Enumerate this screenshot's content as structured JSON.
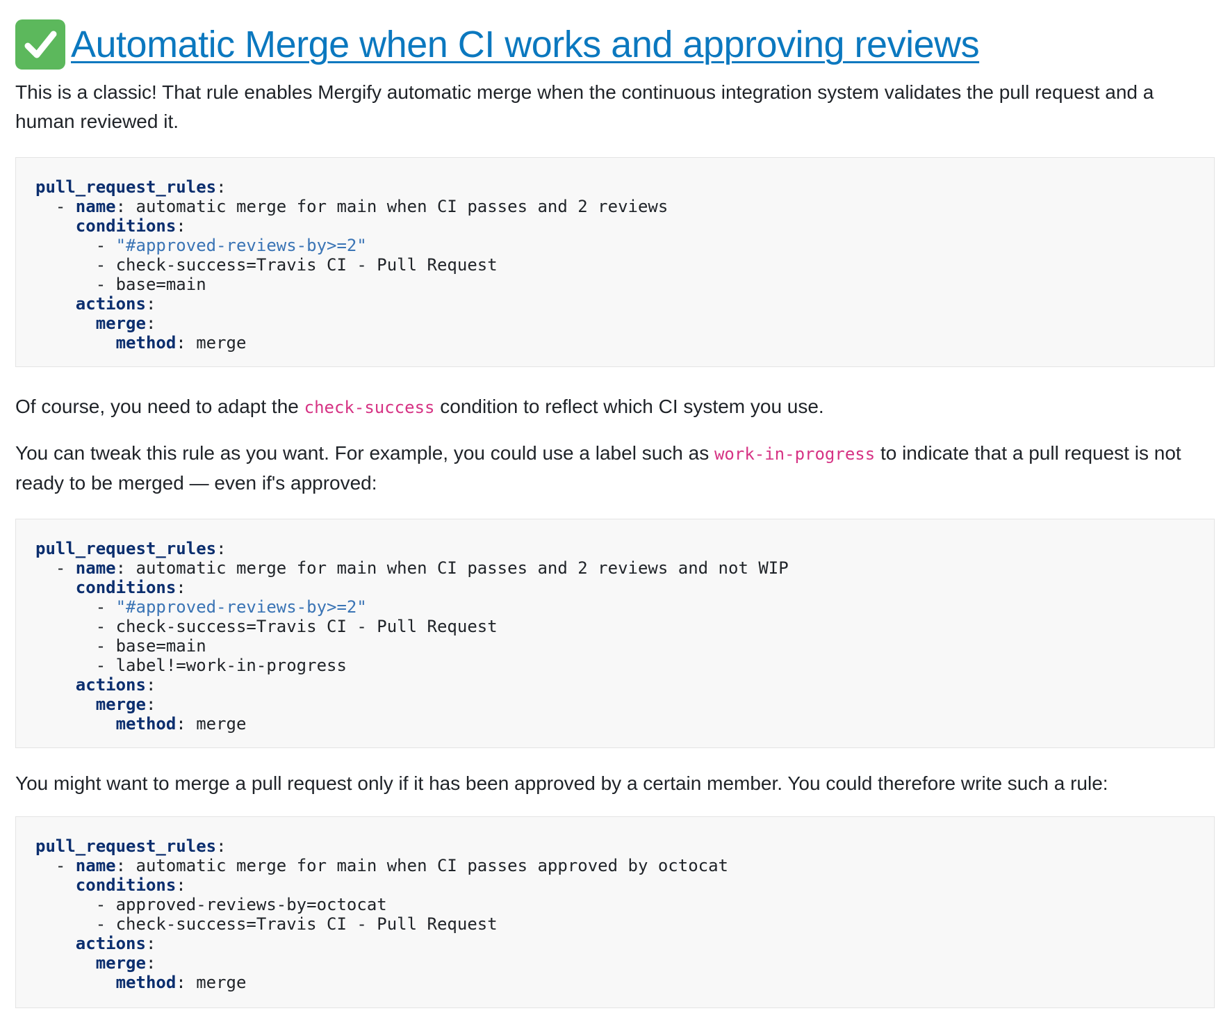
{
  "heading": {
    "icon": "check-mark-button-icon",
    "title": " Automatic Merge when CI works and approving reviews"
  },
  "intro": "This is a classic! That rule enables Mergify automatic merge when the continuous integration system validates the pull request and a human reviewed it.",
  "code_block_1": [
    {
      "indent": "",
      "key": "pull_request_rules",
      "sep": ":",
      "value": "",
      "value_type": "plain"
    },
    {
      "indent": "  - ",
      "key": "name",
      "sep": ": ",
      "value": "automatic merge for main when CI passes and 2 reviews",
      "value_type": "plain"
    },
    {
      "indent": "    ",
      "key": "conditions",
      "sep": ":",
      "value": "",
      "value_type": "plain"
    },
    {
      "indent": "      - ",
      "key": "",
      "sep": "",
      "value": "\"#approved-reviews-by>=2\"",
      "value_type": "string"
    },
    {
      "indent": "      - ",
      "key": "",
      "sep": "",
      "value": "check-success=Travis CI - Pull Request",
      "value_type": "plain"
    },
    {
      "indent": "      - ",
      "key": "",
      "sep": "",
      "value": "base=main",
      "value_type": "plain"
    },
    {
      "indent": "    ",
      "key": "actions",
      "sep": ":",
      "value": "",
      "value_type": "plain"
    },
    {
      "indent": "      ",
      "key": "merge",
      "sep": ":",
      "value": "",
      "value_type": "plain"
    },
    {
      "indent": "        ",
      "key": "method",
      "sep": ": ",
      "value": "merge",
      "value_type": "plain"
    }
  ],
  "para_2": {
    "before": "Of course, you need to adapt the ",
    "code": "check-success",
    "after": " condition to reflect which CI system you use."
  },
  "para_3": {
    "before": "You can tweak this rule as you want. For example, you could use a label such as ",
    "code": "work-in-progress",
    "after": " to indicate that a pull request is not ready to be merged — even if's approved:"
  },
  "code_block_2": [
    {
      "indent": "",
      "key": "pull_request_rules",
      "sep": ":",
      "value": "",
      "value_type": "plain"
    },
    {
      "indent": "  - ",
      "key": "name",
      "sep": ": ",
      "value": "automatic merge for main when CI passes and 2 reviews and not WIP",
      "value_type": "plain"
    },
    {
      "indent": "    ",
      "key": "conditions",
      "sep": ":",
      "value": "",
      "value_type": "plain"
    },
    {
      "indent": "      - ",
      "key": "",
      "sep": "",
      "value": "\"#approved-reviews-by>=2\"",
      "value_type": "string"
    },
    {
      "indent": "      - ",
      "key": "",
      "sep": "",
      "value": "check-success=Travis CI - Pull Request",
      "value_type": "plain"
    },
    {
      "indent": "      - ",
      "key": "",
      "sep": "",
      "value": "base=main",
      "value_type": "plain"
    },
    {
      "indent": "      - ",
      "key": "",
      "sep": "",
      "value": "label!=work-in-progress",
      "value_type": "plain"
    },
    {
      "indent": "    ",
      "key": "actions",
      "sep": ":",
      "value": "",
      "value_type": "plain"
    },
    {
      "indent": "      ",
      "key": "merge",
      "sep": ":",
      "value": "",
      "value_type": "plain"
    },
    {
      "indent": "        ",
      "key": "method",
      "sep": ": ",
      "value": "merge",
      "value_type": "plain"
    }
  ],
  "para_4": "You might want to merge a pull request only if it has been approved by a certain member. You could therefore write such a rule:",
  "code_block_3": [
    {
      "indent": "",
      "key": "pull_request_rules",
      "sep": ":",
      "value": "",
      "value_type": "plain"
    },
    {
      "indent": "  - ",
      "key": "name",
      "sep": ": ",
      "value": "automatic merge for main when CI passes approved by octocat",
      "value_type": "plain"
    },
    {
      "indent": "    ",
      "key": "conditions",
      "sep": ":",
      "value": "",
      "value_type": "plain"
    },
    {
      "indent": "      - ",
      "key": "",
      "sep": "",
      "value": "approved-reviews-by=octocat",
      "value_type": "plain"
    },
    {
      "indent": "      - ",
      "key": "",
      "sep": "",
      "value": "check-success=Travis CI - Pull Request",
      "value_type": "plain"
    },
    {
      "indent": "    ",
      "key": "actions",
      "sep": ":",
      "value": "",
      "value_type": "plain"
    },
    {
      "indent": "      ",
      "key": "merge",
      "sep": ":",
      "value": "",
      "value_type": "plain"
    },
    {
      "indent": "        ",
      "key": "method",
      "sep": ": ",
      "value": "merge",
      "value_type": "plain"
    }
  ],
  "colors": {
    "link": "#0b78bf",
    "check_icon_bg": "#5cb85c",
    "code_key": "#0b2e6e",
    "code_string": "#3a74b5",
    "inline_code": "#d63384",
    "code_bg": "#f8f8f8"
  }
}
